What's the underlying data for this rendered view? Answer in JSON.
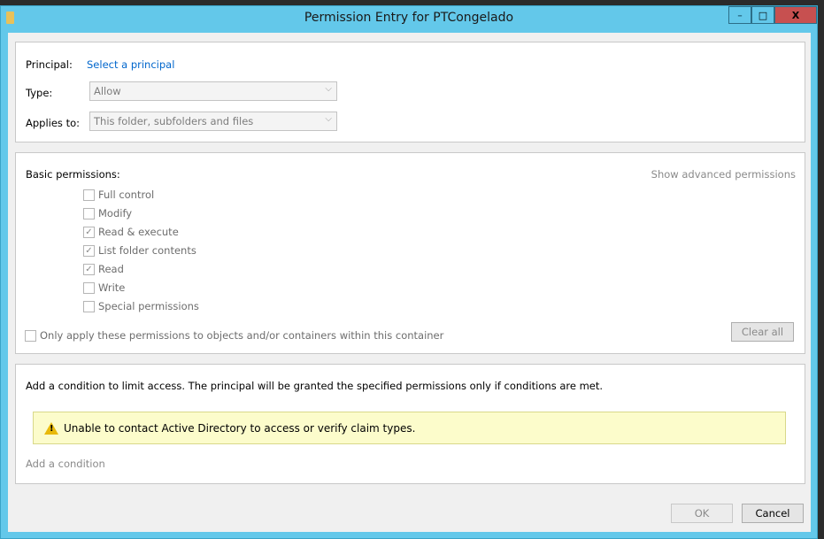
{
  "window": {
    "title": "Permission Entry for PTCongelado",
    "minimize": "–",
    "maximize": "□",
    "close": "X",
    "close_color": "#c75050"
  },
  "principal": {
    "label": "Principal:",
    "link": "Select a principal"
  },
  "type": {
    "label": "Type:",
    "value": "Allow"
  },
  "applies_to": {
    "label": "Applies to:",
    "value": "This folder, subfolders and files"
  },
  "permissions": {
    "label": "Basic permissions:",
    "show_advanced": "Show advanced permissions",
    "items": [
      {
        "label": "Full control",
        "checked": false
      },
      {
        "label": "Modify",
        "checked": false
      },
      {
        "label": "Read & execute",
        "checked": true
      },
      {
        "label": "List folder contents",
        "checked": true
      },
      {
        "label": "Read",
        "checked": true
      },
      {
        "label": "Write",
        "checked": false
      },
      {
        "label": "Special permissions",
        "checked": false
      }
    ],
    "only_apply": "Only apply these permissions to objects and/or containers within this container",
    "clear_all": "Clear all"
  },
  "condition": {
    "description": "Add a condition to limit access. The principal will be granted the specified permissions only if conditions are met.",
    "warning": "Unable to contact Active Directory to access or verify claim types.",
    "add": "Add a condition"
  },
  "buttons": {
    "ok": "OK",
    "cancel": "Cancel"
  }
}
